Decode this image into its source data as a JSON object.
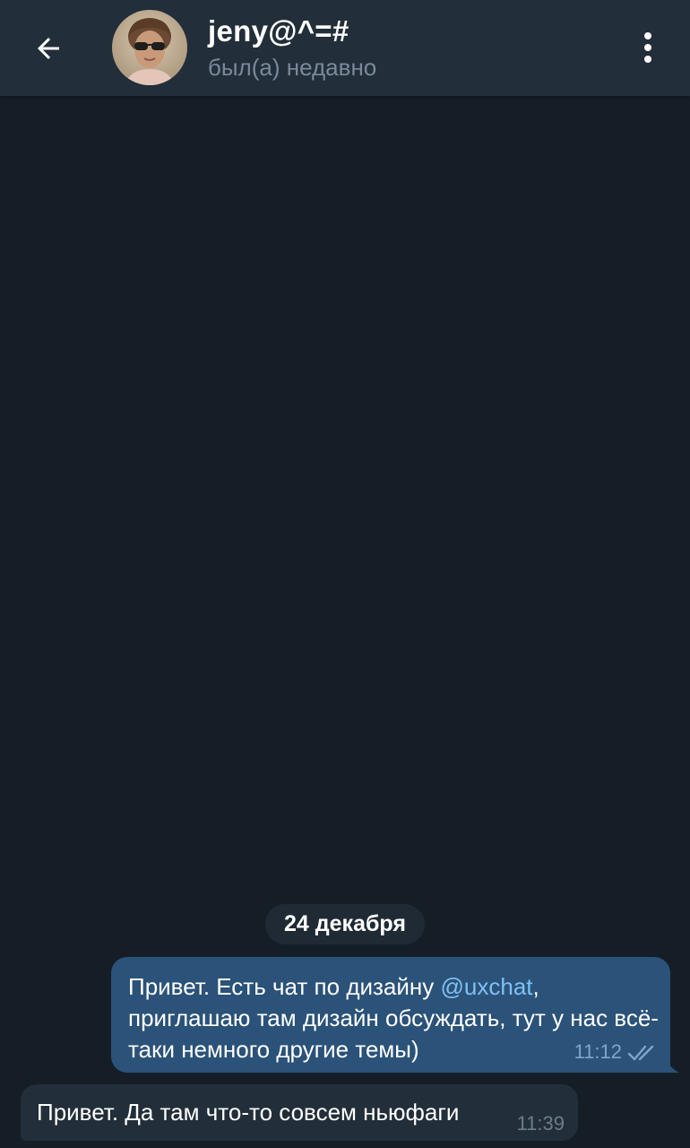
{
  "header": {
    "title": "jeny@^=#",
    "status": "был(а) недавно",
    "back_icon": "arrow-left-icon",
    "menu_icon": "more-vertical-icon"
  },
  "chat": {
    "date_separator": "24 декабря",
    "messages": [
      {
        "direction": "outgoing",
        "text_before": "Привет. Есть чат по дизайну ",
        "mention": "@uxchat",
        "text_after": ", приглашаю там дизайн обсуждать, тут у нас всё-таки немного другие темы)",
        "time": "11:12",
        "read_status_icon": "double-check-icon"
      },
      {
        "direction": "incoming",
        "text": "Привет. Да там что-то совсем ньюфаги",
        "time": "11:39"
      }
    ]
  },
  "colors": {
    "background": "#151e26",
    "header": "#222e39",
    "outgoing_bubble": "#2b5278",
    "incoming_bubble": "#222e39",
    "link": "#7fc0f5"
  }
}
